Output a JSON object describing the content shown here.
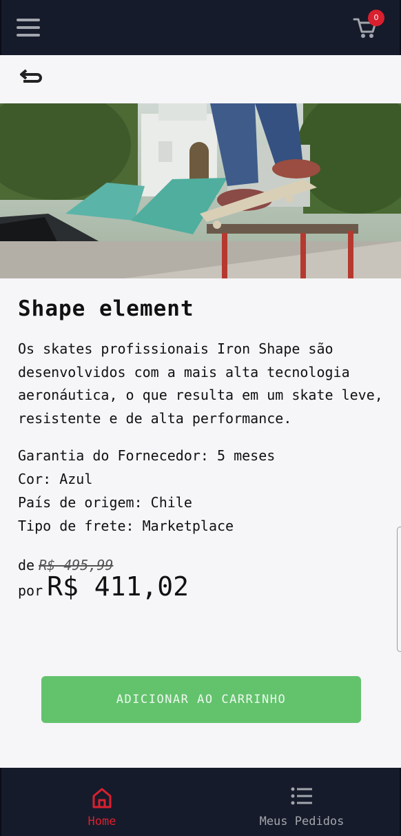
{
  "header": {
    "title": "",
    "menu_icon": "hamburger-menu-icon",
    "cart_icon": "shopping-cart-icon",
    "cart_count": "0",
    "background": "#161b2b",
    "badge_color": "#d9202f"
  },
  "nav": {
    "back_icon": "return-arrow-icon"
  },
  "product": {
    "image_desc_icon": "product-photo",
    "title": "Shape element",
    "description": "Os skates profissionais Iron Shape são desenvolvidos com a mais alta tecnologia aeronáutica, o que resulta em um skate leve, resistente e de alta performance.",
    "specs": [
      "Garantia do Fornecedor: 5 meses",
      "Cor: Azul",
      "País de origem: Chile",
      "Tipo de frete: Marketplace"
    ],
    "price_from_label": "de",
    "old_price": "R$ 495,99",
    "price_to_label": "por",
    "new_price": "R$ 411,02"
  },
  "actions": {
    "add_to_cart_label": "ADICIONAR AO CARRINHO",
    "button_color": "#63c36d"
  },
  "bottom_nav": {
    "items": [
      {
        "label": "Home",
        "icon": "home-icon",
        "active": true,
        "color": "#d9202f"
      },
      {
        "label": "Meus Pedidos",
        "icon": "list-icon",
        "active": false,
        "color": "#a3a6ad"
      }
    ]
  }
}
